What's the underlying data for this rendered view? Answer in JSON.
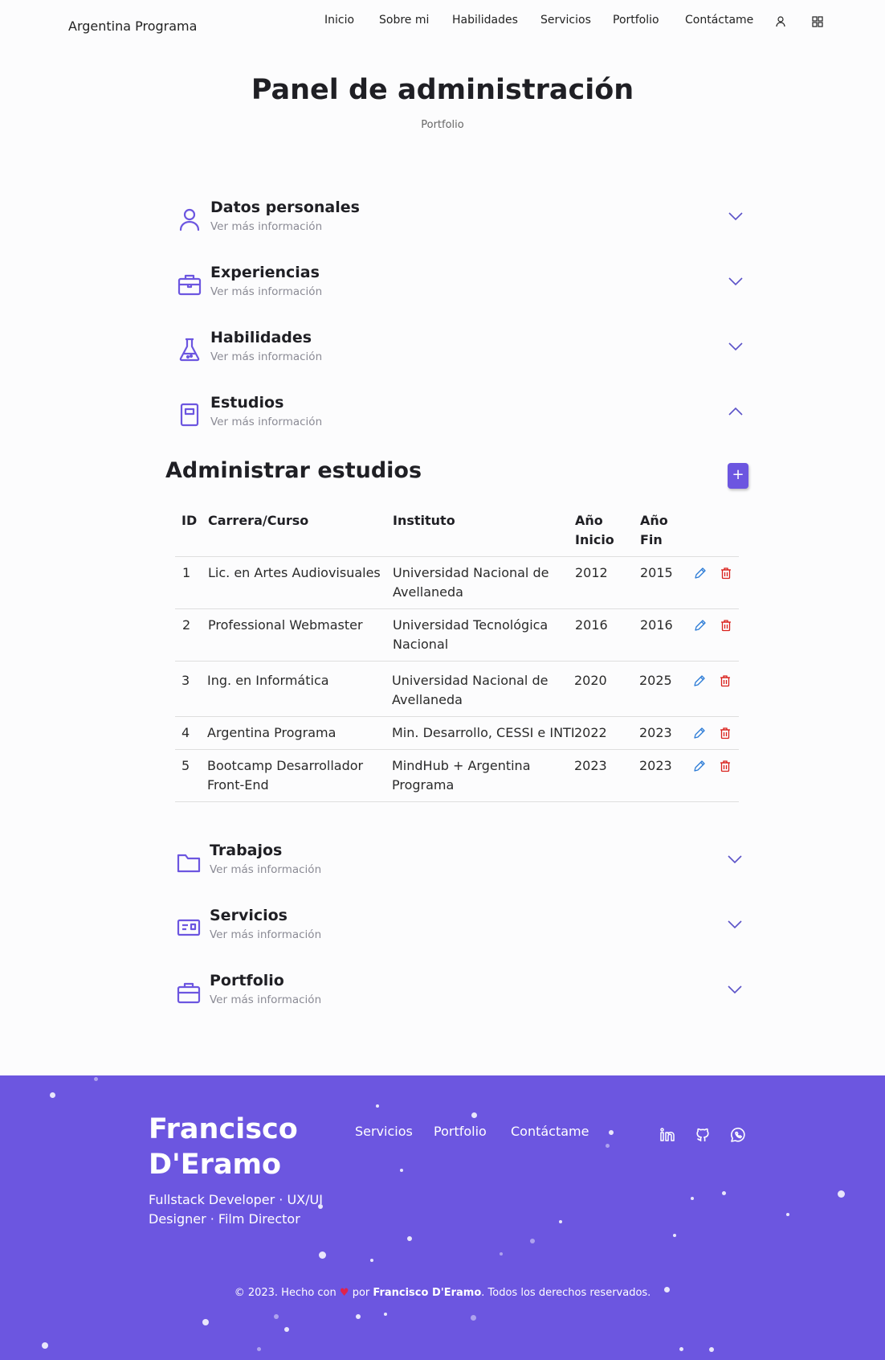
{
  "header": {
    "logo": "Argentina Programa",
    "nav": [
      "Inicio",
      "Sobre mi",
      "Habilidades",
      "Servicios",
      "Portfolio",
      "Contáctame"
    ],
    "icons": [
      "user-icon",
      "apps-icon"
    ]
  },
  "page": {
    "title": "Panel de administración",
    "subtitle": "Portfolio"
  },
  "accordion": [
    {
      "title": "Datos personales",
      "sub": "Ver más información",
      "icon": "user-icon",
      "open": false
    },
    {
      "title": "Experiencias",
      "sub": "Ver más información",
      "icon": "briefcase-icon",
      "open": false
    },
    {
      "title": "Habilidades",
      "sub": "Ver más información",
      "icon": "flask-icon",
      "open": false
    },
    {
      "title": "Estudios",
      "sub": "Ver más información",
      "icon": "book-icon",
      "open": true
    },
    {
      "title": "Trabajos",
      "sub": "Ver más información",
      "icon": "folder-icon",
      "open": false
    },
    {
      "title": "Servicios",
      "sub": "Ver más información",
      "icon": "id-card-icon",
      "open": false
    },
    {
      "title": "Portfolio",
      "sub": "Ver más información",
      "icon": "briefcase-icon",
      "open": false
    }
  ],
  "studies": {
    "title": "Administrar estudios",
    "add_label": "+",
    "headers": {
      "id": "ID",
      "career": "Carrera/Curso",
      "institute": "Instituto",
      "start_1": "Año",
      "start_2": "Inicio",
      "end_1": "Año",
      "end_2": "Fin"
    },
    "rows": [
      {
        "id": "1",
        "career": [
          "Lic. en Artes Audiovisuales"
        ],
        "institute": [
          "Universidad Nacional de",
          "Avellaneda"
        ],
        "start": "2012",
        "end": "2015"
      },
      {
        "id": "2",
        "career": [
          "Professional Webmaster"
        ],
        "institute": [
          "Universidad Tecnológica",
          "Nacional"
        ],
        "start": "2016",
        "end": "2016"
      },
      {
        "id": "3",
        "career": [
          "Ing. en Informática"
        ],
        "institute": [
          "Universidad Nacional de",
          "Avellaneda"
        ],
        "start": "2020",
        "end": "2025"
      },
      {
        "id": "4",
        "career": [
          "Argentina Programa"
        ],
        "institute": [
          "Min. Desarrollo, CESSI e INTI"
        ],
        "start": "2022",
        "end": "2023"
      },
      {
        "id": "5",
        "career": [
          "Bootcamp Desarrollador",
          "Front-End"
        ],
        "institute": [
          "MindHub + Argentina",
          "Programa"
        ],
        "start": "2023",
        "end": "2023"
      }
    ]
  },
  "footer": {
    "name_1": "Francisco",
    "name_2": "D'Eramo",
    "tagline_1": "Fullstack Developer · UX/UI",
    "tagline_2": "Designer · Film Director",
    "links": [
      "Servicios",
      "Portfolio",
      "Contáctame"
    ],
    "social": [
      "linkedin-icon",
      "github-icon",
      "whatsapp-icon"
    ],
    "copyright_pre": "© 2023. Hecho con",
    "copyright_heart": "♥",
    "copyright_mid": "por",
    "copyright_author": "Francisco D'Eramo",
    "copyright_post": ". Todos los derechos reservados.",
    "bg_color": "#6c56e0"
  },
  "colors": {
    "accent": "#6c56e0",
    "edit": "#2b7bd6",
    "delete": "#d9201b"
  }
}
